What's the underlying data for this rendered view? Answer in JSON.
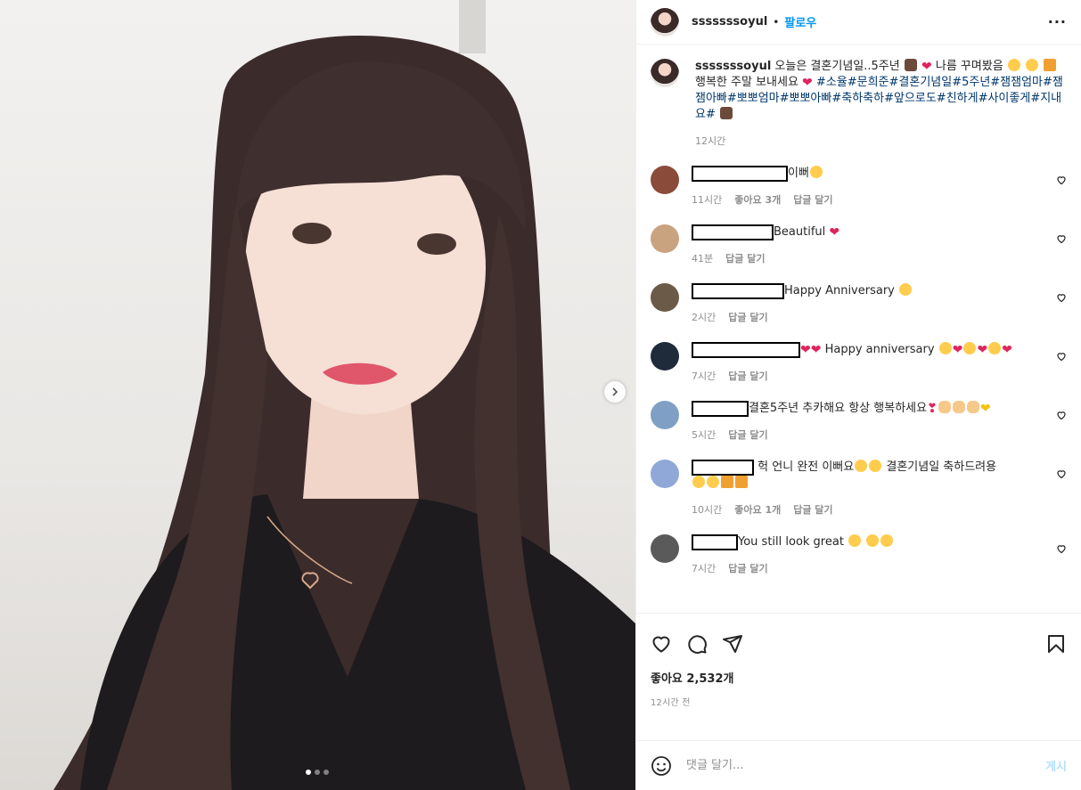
{
  "post": {
    "username": "sssssssoyul",
    "follow_label": "팔로우",
    "separator": "•",
    "more_label": "···",
    "caption_text": "오늘은 결혼기념일..5주년",
    "caption_text2": "나름 꾸며봤음",
    "caption_line2": "행복한 주말 보내세요",
    "hashtags": "#소율#문희준#결혼기념일#5주년#잼잼엄마#잼잼아빠#뽀뽀엄마#뽀뽀아빠#축하축하#앞으로도#친하게#사이좋게#지내요#",
    "caption_time": "12시간"
  },
  "comments": [
    {
      "text": "이뻐",
      "time": "11시간",
      "likes": "좋아요 3개",
      "reply": "답글 달기",
      "avatar_color": "#8a4b3a"
    },
    {
      "text": "Beautiful",
      "time": "41분",
      "likes": "",
      "reply": "답글 달기",
      "avatar_color": "#c9a37f"
    },
    {
      "text": "Happy Anniversary",
      "time": "2시간",
      "likes": "",
      "reply": "답글 달기",
      "avatar_color": "#6b5a48"
    },
    {
      "text": "Happy anniversary",
      "time": "7시간",
      "likes": "",
      "reply": "답글 달기",
      "avatar_color": "#1f2a3a"
    },
    {
      "text": "결혼5주년 추카해요 항상 행복하세요",
      "time": "5시간",
      "likes": "",
      "reply": "답글 달기",
      "avatar_color": "#7fa0c4"
    },
    {
      "text": "헉 언니 완전 이뻐요",
      "text2": "결혼기념일 축하드려용",
      "time": "10시간",
      "likes": "좋아요 1개",
      "reply": "답글 달기",
      "avatar_color": "#8fa8d8"
    },
    {
      "text": "You still look great",
      "time": "7시간",
      "likes": "",
      "reply": "답글 달기",
      "avatar_color": "#5a5a5a"
    }
  ],
  "footer": {
    "likes": "좋아요 2,532개",
    "posted": "12시간 전",
    "comment_placeholder": "댓글 달기...",
    "post_label": "게시"
  },
  "carousel": {
    "count": 3,
    "active": 0
  }
}
